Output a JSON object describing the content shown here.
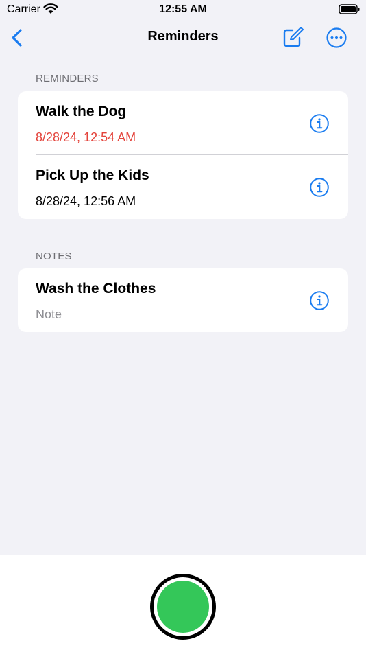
{
  "status": {
    "carrier": "Carrier",
    "time": "12:55 AM"
  },
  "nav": {
    "title": "Reminders",
    "back_icon": "chevron-left-icon",
    "compose_icon": "compose-icon",
    "more_icon": "ellipsis-circle-icon"
  },
  "reminders": {
    "header": "REMINDERS",
    "items": [
      {
        "title": "Walk the Dog",
        "date": "8/28/24, 12:54 AM",
        "overdue": true
      },
      {
        "title": "Pick Up the Kids",
        "date": "8/28/24, 12:56 AM",
        "overdue": false
      }
    ]
  },
  "notes": {
    "header": "NOTES",
    "items": [
      {
        "title": "Wash the Clothes",
        "subtitle": "Note"
      }
    ]
  },
  "colors": {
    "accent": "#1a7cf0",
    "overdue": "#e4433b",
    "record": "#34c759",
    "background": "#f2f2f7"
  }
}
